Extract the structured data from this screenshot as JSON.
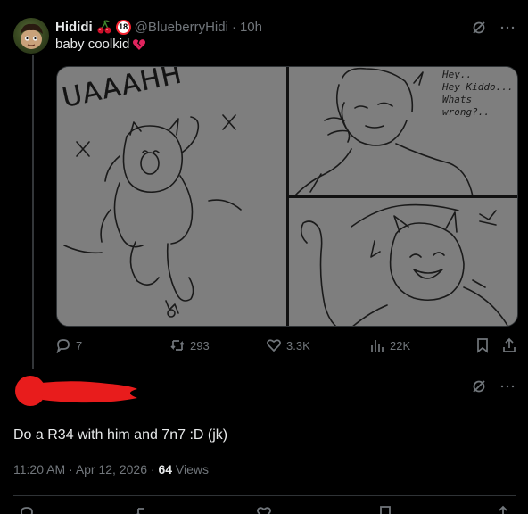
{
  "post": {
    "display_name": "Hididi",
    "age_badge": "18",
    "handle": "@BlueberryHidi",
    "separator": "·",
    "time": "10h",
    "text": "baby coolkid",
    "emojis": [
      "cherries",
      "18-badge",
      "broken-heart"
    ]
  },
  "media": {
    "panel_left": {
      "shout": "UAAAHH"
    },
    "panel_top_right": {
      "speech": "Hey..\nHey Kiddo...\nWhats\nwrong?.."
    }
  },
  "engagement": {
    "replies": "7",
    "reposts": "293",
    "likes": "3.3K",
    "views": "22K"
  },
  "reply": {
    "author": "redacted",
    "text": "Do a R34 with him and 7n7 :D (jk)",
    "time": "11:20 AM",
    "date": "Apr 12, 2026",
    "sep1": "·",
    "sep2": "·",
    "views_count": "64",
    "views_label": "Views"
  },
  "colors": {
    "background": "#000000",
    "text_primary": "#e7e9ea",
    "text_secondary": "#71767b",
    "redaction": "#e81c1c",
    "divider": "#2f3336"
  }
}
